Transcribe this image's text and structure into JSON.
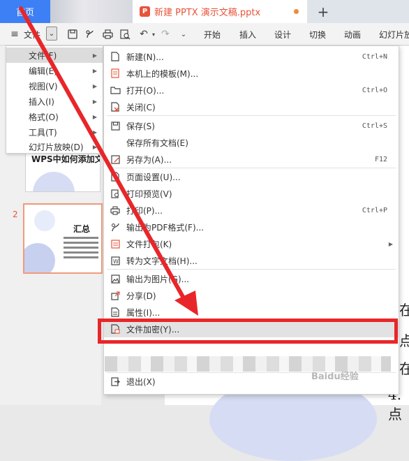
{
  "tabs": {
    "home": "首页",
    "document": "新建 PPTX 演示文稿.pptx",
    "doc_icon": "P"
  },
  "toolbar": {
    "file": "文件",
    "ribbon": [
      "开始",
      "插入",
      "设计",
      "切换",
      "动画",
      "幻灯片放"
    ]
  },
  "file_menu": [
    {
      "label": "文件(F)",
      "active": true
    },
    {
      "label": "编辑(E)"
    },
    {
      "label": "视图(V)"
    },
    {
      "label": "插入(I)"
    },
    {
      "label": "格式(O)"
    },
    {
      "label": "工具(T)"
    },
    {
      "label": "幻灯片放映(D)"
    }
  ],
  "submenu": [
    {
      "label": "新建(N)...",
      "shortcut": "Ctrl+N",
      "icon": "new-file-icon"
    },
    {
      "label": "本机上的模板(M)...",
      "icon": "template-icon"
    },
    {
      "label": "打开(O)...",
      "shortcut": "Ctrl+O",
      "icon": "folder-open-icon"
    },
    {
      "label": "关闭(C)",
      "icon": "close-file-icon"
    },
    {
      "label": "保存(S)",
      "shortcut": "Ctrl+S",
      "icon": "save-icon"
    },
    {
      "label": "保存所有文档(E)"
    },
    {
      "label": "另存为(A)...",
      "shortcut": "F12",
      "icon": "save-as-icon"
    },
    {
      "label": "页面设置(U)...",
      "icon": "page-setup-icon"
    },
    {
      "label": "打印预览(V)",
      "icon": "print-preview-icon"
    },
    {
      "label": "打印(P)...",
      "shortcut": "Ctrl+P",
      "icon": "print-icon"
    },
    {
      "label": "输出为PDF格式(F)...",
      "icon": "pdf-icon"
    },
    {
      "label": "文件打包(K)",
      "icon": "package-icon"
    },
    {
      "label": "转为文字文档(H)...",
      "icon": "to-text-icon"
    },
    {
      "label": "输出为图片(G)...",
      "icon": "image-export-icon"
    },
    {
      "label": "分享(D)",
      "icon": "share-icon"
    },
    {
      "label": "属性(I)...",
      "icon": "properties-icon"
    },
    {
      "label": "文件加密(Y)...",
      "icon": "encrypt-icon"
    },
    {
      "label": "退出(X)",
      "icon": "exit-icon"
    }
  ],
  "slides": {
    "slide1_title": "WPS中如何添加文",
    "slide2_num": "2",
    "slide2_title": "汇总"
  },
  "right_text": [
    "在",
    "点",
    "在",
    "4.点"
  ],
  "watermark": "Baidu经验",
  "colors": {
    "accent_blue": "#3d7ff5",
    "doc_orange": "#e8533a",
    "highlight_red": "#e8262a"
  }
}
